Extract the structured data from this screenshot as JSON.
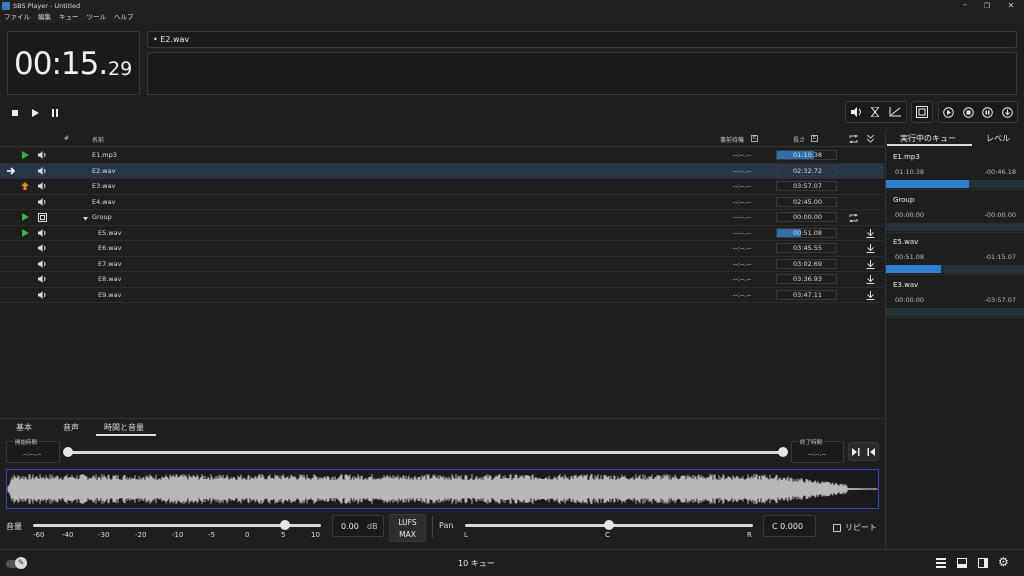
{
  "window": {
    "title": "SBS Player - Untitled"
  },
  "menu": [
    "ファイル",
    "編集",
    "キュー",
    "ツール",
    "ヘルプ"
  ],
  "clock": {
    "main": "00:15.",
    "fraction": "29"
  },
  "next_cue": "• E2.wav",
  "table": {
    "headers": {
      "num": "#",
      "name": "名前",
      "prewait": "事前待機",
      "length": "長さ"
    },
    "rows": [
      {
        "name": "E1.mp3",
        "prewait": "--:--.--",
        "length": "01:10.38",
        "status": "play",
        "icon": "speaker",
        "progress": 0.62,
        "action": ""
      },
      {
        "name": "E2.wav",
        "prewait": "--:--.--",
        "length": "02:32.72",
        "status": "arrow",
        "icon": "speaker",
        "progress": 0,
        "action": "",
        "selected": true
      },
      {
        "name": "E3.wav",
        "prewait": "--:--.--",
        "length": "03:57.07",
        "status": "up",
        "icon": "speaker",
        "progress": 0,
        "action": ""
      },
      {
        "name": "E4.wav",
        "prewait": "--:--.--",
        "length": "02:45.00",
        "status": "",
        "icon": "speaker",
        "progress": 0,
        "action": ""
      },
      {
        "name": "Group",
        "prewait": "--:--.--",
        "length": "00:00.00",
        "status": "play",
        "icon": "group",
        "progress": 0,
        "action": "loop",
        "group": true
      },
      {
        "name": "E5.wav",
        "prewait": "--:--.--",
        "length": "00:51.08",
        "status": "play",
        "icon": "speaker",
        "progress": 0.4,
        "action": "down",
        "indent": true
      },
      {
        "name": "E6.wav",
        "prewait": "--:--.--",
        "length": "03:45.55",
        "status": "",
        "icon": "speaker",
        "progress": 0,
        "action": "down",
        "indent": true
      },
      {
        "name": "E7.wav",
        "prewait": "--:--.--",
        "length": "03:02.69",
        "status": "",
        "icon": "speaker",
        "progress": 0,
        "action": "down",
        "indent": true
      },
      {
        "name": "E8.wav",
        "prewait": "--:--.--",
        "length": "03:36.93",
        "status": "",
        "icon": "speaker",
        "progress": 0,
        "action": "down",
        "indent": true
      },
      {
        "name": "E9.wav",
        "prewait": "--:--.--",
        "length": "03:47.11",
        "status": "",
        "icon": "speaker",
        "progress": 0,
        "action": "down",
        "indent": true
      }
    ]
  },
  "right_tabs": {
    "active": "実行中のキュー",
    "levels": "レベル"
  },
  "running": [
    {
      "name": "E1.mp3",
      "elapsed": "01:10.38",
      "remaining": "-00:46.18",
      "progress": 0.6
    },
    {
      "name": "Group",
      "elapsed": "00:00.00",
      "remaining": "-00:00.00",
      "progress": 0
    },
    {
      "name": "E5.wav",
      "elapsed": "00:51.08",
      "remaining": "-01:15.07",
      "progress": 0.4
    },
    {
      "name": "E3.wav",
      "elapsed": "00:00.00",
      "remaining": "-03:57.07",
      "progress": 0
    }
  ],
  "bottom_tabs": [
    "基本",
    "音声",
    "時間と音量"
  ],
  "time_volume": {
    "start_label": "開始時間",
    "start_value": "--:--.--",
    "end_label": "終了時間",
    "end_value": "--:--.--",
    "volume_label": "音量",
    "volume_ticks": [
      "-60",
      "-40",
      "-30",
      "-20",
      "-10",
      "-5",
      "0",
      "5",
      "10"
    ],
    "volume_position": 0.875,
    "db_value": "0.00",
    "db_unit": "dB",
    "lufs": "LUFS",
    "max": "MAX",
    "pan_label": "Pan",
    "pan_ticks": [
      "L",
      "C",
      "R"
    ],
    "pan_position": 0.5,
    "pan_value": "C 0.000",
    "repeat_label": "リピート"
  },
  "status": {
    "cue_count": "10 キュー"
  },
  "colors": {
    "accent": "#2f6ea8",
    "play": "#3cb043",
    "up": "#e08a1e",
    "selected_row": "#26374a"
  }
}
